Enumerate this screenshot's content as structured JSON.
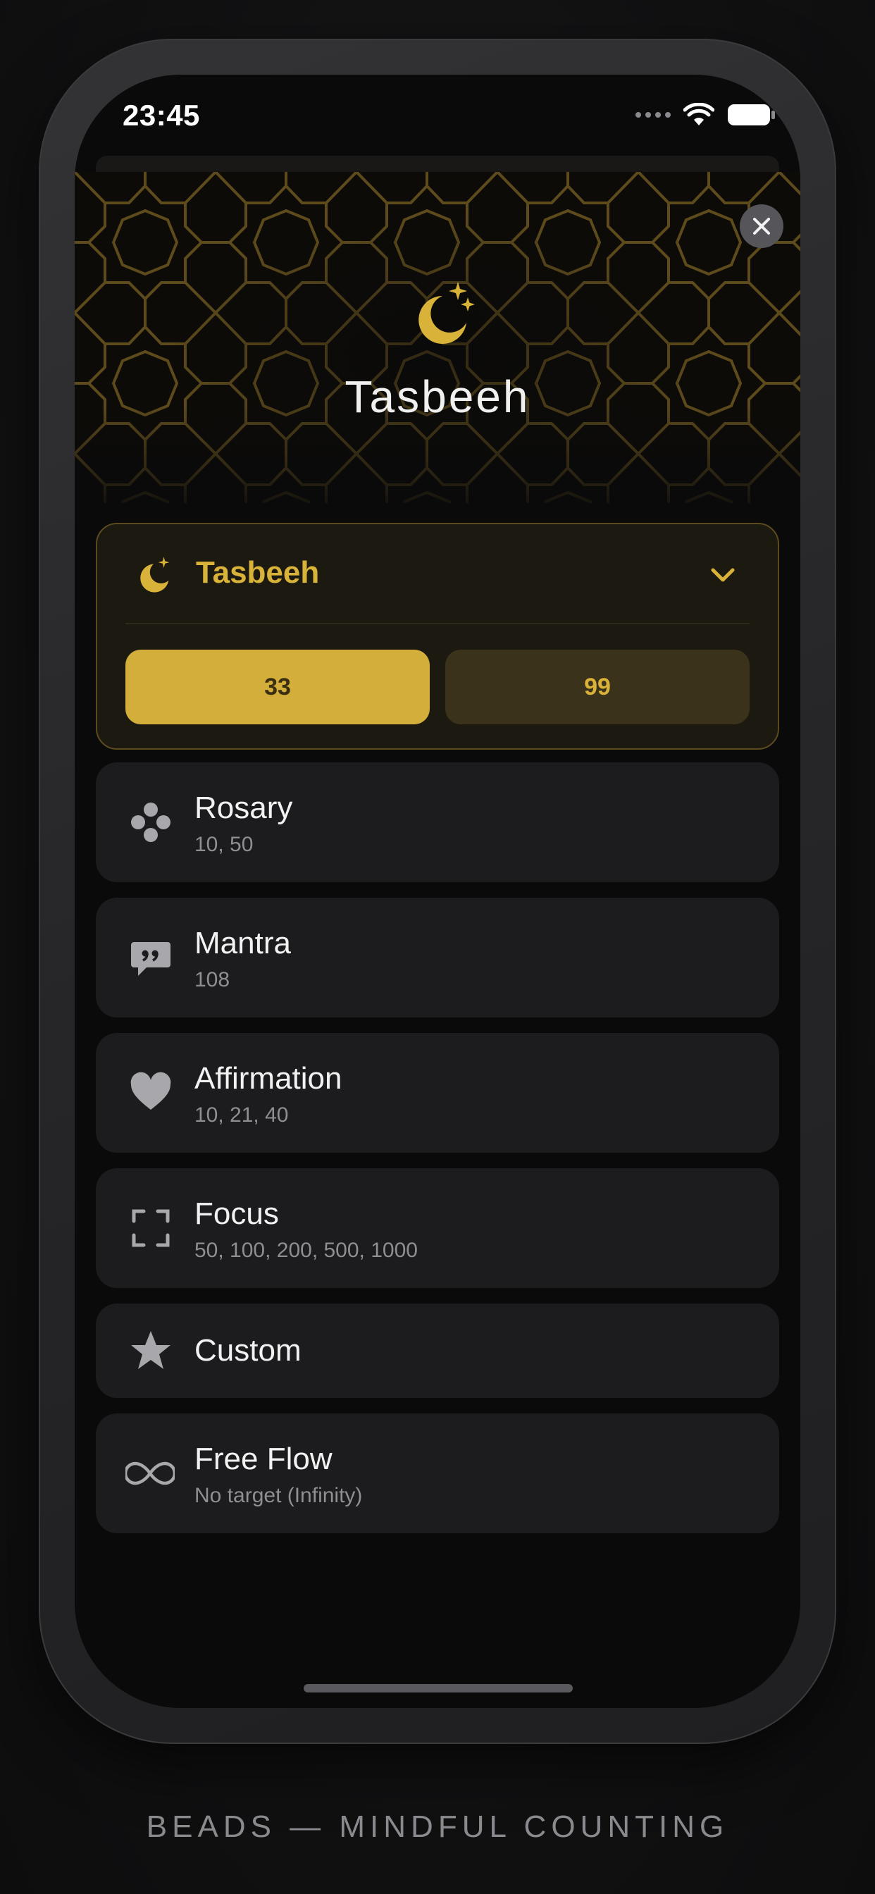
{
  "status_bar": {
    "time": "23:45"
  },
  "header": {
    "title": "Tasbeeh",
    "icon": "crescent-stars-icon",
    "close_icon": "close-icon"
  },
  "colors": {
    "accent": "#d4ae3a",
    "accent_text": "#d9b23a",
    "card": "#1c1c1e",
    "subtext": "#8e8e93"
  },
  "selected_preset": {
    "label": "Tasbeeh",
    "icon": "crescent-stars-icon",
    "options": [
      {
        "label": "33",
        "active": true
      },
      {
        "label": "99",
        "active": false
      }
    ]
  },
  "presets": [
    {
      "label": "Rosary",
      "subtitle": "10, 50",
      "icon": "rosary-beads-icon"
    },
    {
      "label": "Mantra",
      "subtitle": "108",
      "icon": "quote-bubble-icon"
    },
    {
      "label": "Affirmation",
      "subtitle": "10, 21, 40",
      "icon": "heart-icon"
    },
    {
      "label": "Focus",
      "subtitle": "50, 100, 200, 500, 1000",
      "icon": "focus-frame-icon"
    },
    {
      "label": "Custom",
      "subtitle": "",
      "icon": "star-icon"
    },
    {
      "label": "Free Flow",
      "subtitle": "No target (Infinity)",
      "icon": "infinity-icon"
    }
  ],
  "footer": {
    "caption": "BEADS — MINDFUL COUNTING"
  }
}
